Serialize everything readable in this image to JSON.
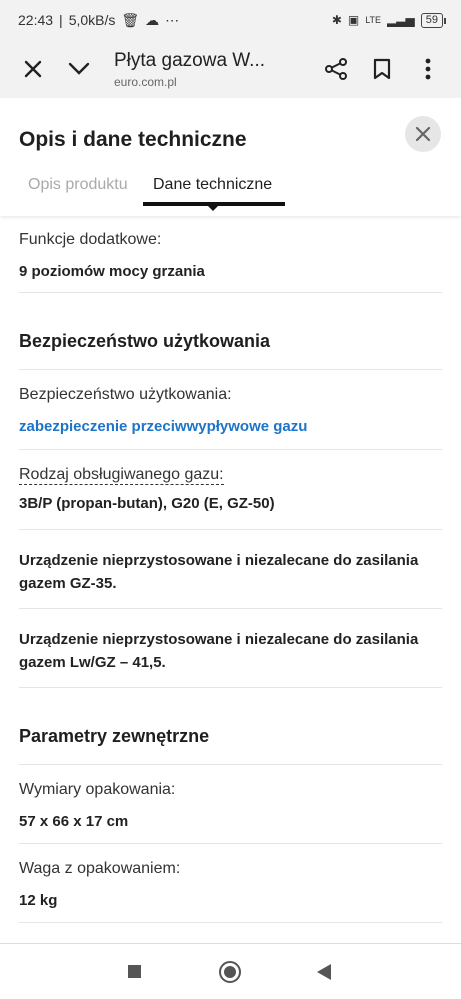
{
  "status_bar": {
    "time": "22:43",
    "speed": "5,0kB/s",
    "network": "LTE",
    "battery": "59"
  },
  "browser": {
    "title": "Płyta gazowa W...",
    "url": "euro.com.pl"
  },
  "sheet": {
    "title": "Opis i dane techniczne",
    "tabs": [
      "Opis produktu",
      "Dane techniczne"
    ],
    "active_tab": "Dane techniczne"
  },
  "content": {
    "funkcje": {
      "label": "Funkcje dodatkowe:",
      "value": "9 poziomów mocy grzania"
    },
    "section_safety": "Bezpieczeństwo użytkowania",
    "safety": {
      "label": "Bezpieczeństwo użytkowania:",
      "value": "zabezpieczenie przeciwwypływowe gazu"
    },
    "gas": {
      "label": "Rodzaj obsługiwanego gazu:",
      "value": "3B/P (propan-butan), G20 (E, GZ-50)"
    },
    "note1": "Urządzenie nieprzystosowane i niezalecane do zasilania gazem GZ-35.",
    "note2": "Urządzenie nieprzystosowane i niezalecane do zasilania gazem Lw/GZ – 41,5.",
    "section_params": "Parametry zewnętrzne",
    "dims": {
      "label": "Wymiary opakowania:",
      "value": "57 x 66 x 17 cm"
    },
    "weight": {
      "label": "Waga z opakowaniem:",
      "value": "12 kg"
    }
  },
  "colors": {
    "link": "#1d74c8",
    "accent_dark": "#111111"
  }
}
